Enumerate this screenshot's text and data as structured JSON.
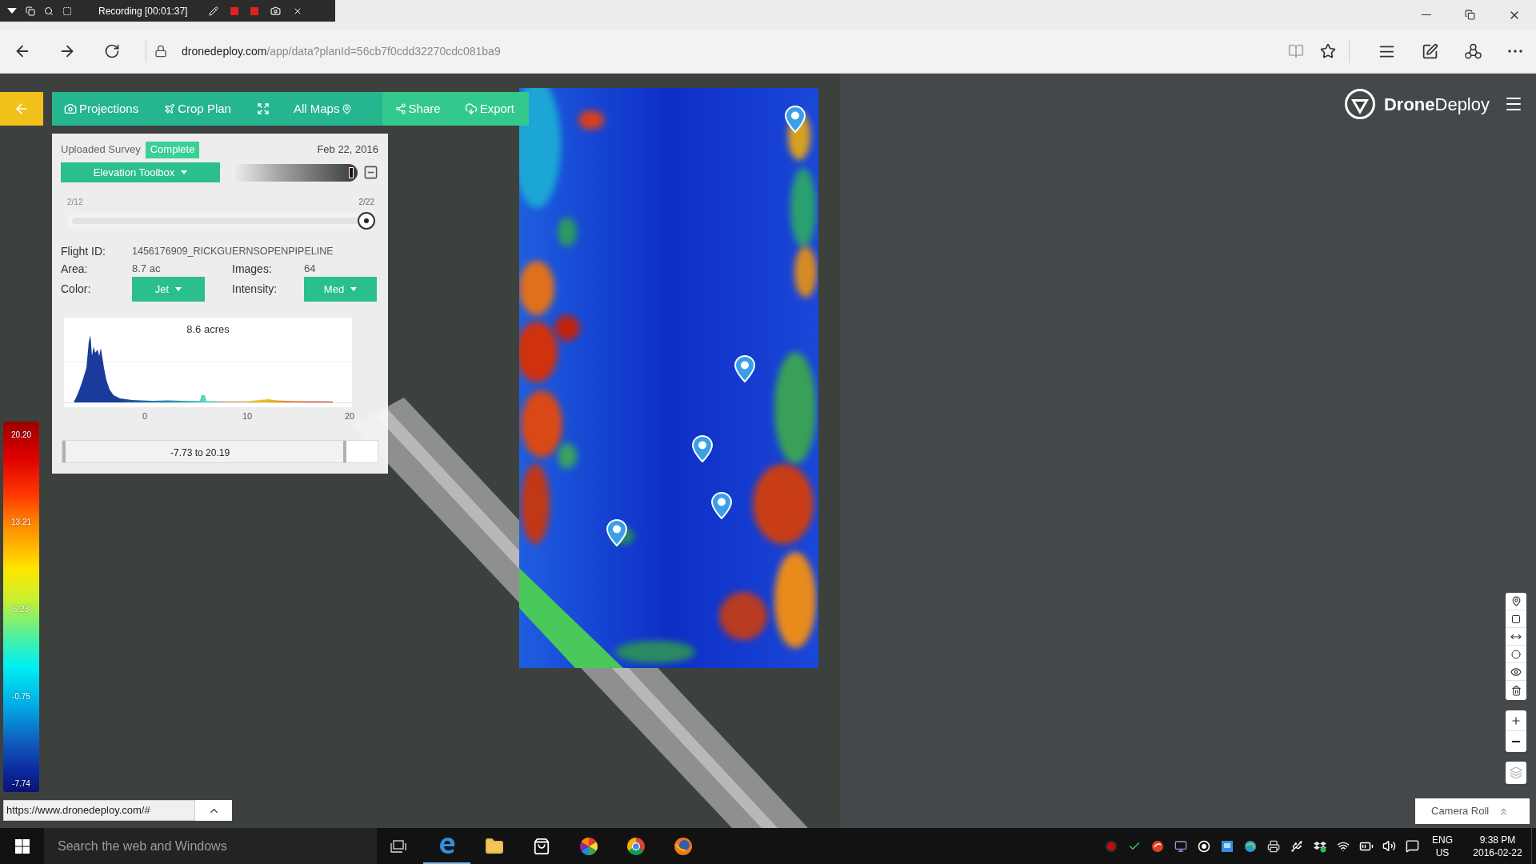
{
  "recorder": {
    "status": "Recording [00:01:37]"
  },
  "browser": {
    "url_domain": "dronedeploy.com",
    "url_path": "/app/data?planId=56cb7f0cdd32270cdc081ba9"
  },
  "toolbar": {
    "projections": "Projections",
    "crop_plan": "Crop Plan",
    "all_maps": "All Maps",
    "share": "Share",
    "export": "Export"
  },
  "panel": {
    "source": "Uploaded Survey",
    "status": "Complete",
    "date": "Feb 22, 2016",
    "toolbox_menu": "Elevation Toolbox",
    "opacity_slider": {
      "level": 0.97
    },
    "timeline": {
      "start": "2/12",
      "end": "2/22",
      "level": 1
    },
    "flight_id_label": "Flight ID:",
    "flight_id": "1456176909_RICKGUERNSOPENPIPELINE",
    "area_label": "Area:",
    "area": "8.7 ac",
    "images_label": "Images:",
    "images": "64",
    "color_label": "Color:",
    "color_menu": "Jet",
    "intensity_label": "Intensity:",
    "intensity_menu": "Med",
    "histogram": {
      "title": "8.6 acres",
      "tick_labels": [
        "0",
        "10",
        "20"
      ]
    },
    "range": {
      "label": "-7.73 to 20.19",
      "level": 0.9
    }
  },
  "logo": {
    "text": "**Drone**Deploy"
  },
  "legend": {
    "labels": [
      "20.20",
      "13.21",
      "6.23",
      "-0.75",
      "-7.74"
    ]
  },
  "status_url": "https://www.dronedeploy.com/#",
  "notification": {
    "title": "Camera Roll"
  },
  "taskbar": {
    "search": {
      "placeholder": "Search the web and Windows"
    },
    "language": {
      "primary": "ENG",
      "region": "US"
    },
    "clock": {
      "time": "9:38 PM",
      "date": "2016-02-22"
    }
  }
}
